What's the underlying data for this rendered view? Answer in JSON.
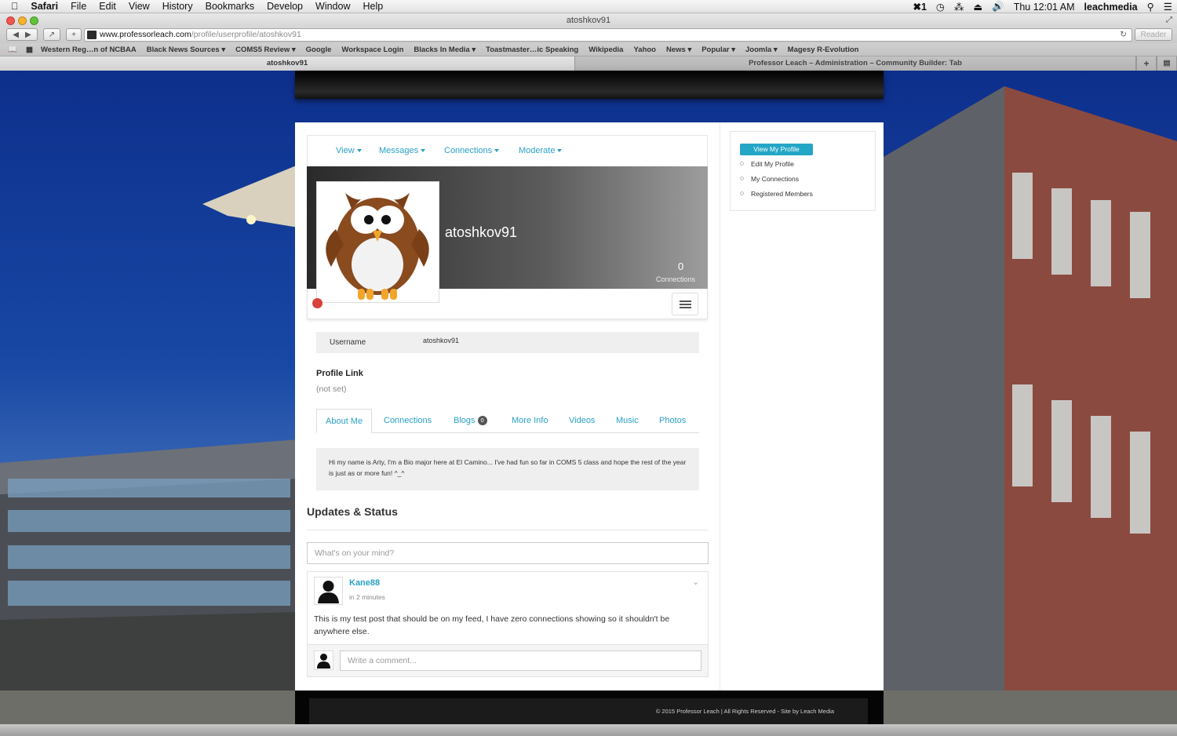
{
  "menubar": {
    "app": "Safari",
    "items": [
      "File",
      "Edit",
      "View",
      "History",
      "Bookmarks",
      "Develop",
      "Window",
      "Help"
    ],
    "status_badge": "1",
    "clock": "Thu 12:01 AM",
    "user": "leachmedia"
  },
  "window": {
    "title": "atoshkov91"
  },
  "toolbar": {
    "url_host": "www.professorleach.com",
    "url_path": "/profile/userprofile/atoshkov91",
    "reader_label": "Reader"
  },
  "bookmarks": [
    "Western Reg…n of NCBAA",
    "Black News Sources ▾",
    "COMS5 Review ▾",
    "Google",
    "Workspace Login",
    "Blacks In Media ▾",
    "Toastmaster…ic Speaking",
    "Wikipedia",
    "Yahoo",
    "News ▾",
    "Popular ▾",
    "Joomla ▾",
    "Magesy R-Evolution"
  ],
  "tabs": [
    {
      "label": "atoshkov91"
    },
    {
      "label": "Professor Leach – Administration – Community Builder: Tab"
    }
  ],
  "profile": {
    "nav": [
      "View",
      "Messages",
      "Connections",
      "Moderate"
    ],
    "display_name": "atoshkov91",
    "connections_count": "0",
    "connections_label": "Connections",
    "username_label": "Username",
    "username_value": "atoshkov91",
    "profile_link_title": "Profile Link",
    "profile_link_value": "(not set)",
    "tabs": [
      "About Me",
      "Connections",
      "Blogs",
      "More Info",
      "Videos",
      "Music",
      "Photos"
    ],
    "blogs_badge": "0",
    "about_text": "Hi my name is Arty, I'm a Bio major here at El Camino... I've had fun so far in COMS 5 class and hope the rest of the year is just as or more fun! ^_^"
  },
  "updates": {
    "title": "Updates & Status",
    "status_placeholder": "What's on your mind?",
    "post": {
      "author": "Kane88",
      "time": "in 2 minutes",
      "text": "This is my test post that should be on my feed, I have zero connections showing so it shouldn't be anywhere else."
    },
    "comment_placeholder": "Write a comment..."
  },
  "sidebar": {
    "items": [
      "View My Profile",
      "Edit My Profile",
      "My Connections",
      "Registered Members"
    ]
  },
  "footer": {
    "text": "© 2015 Professor Leach | All Rights Reserved - Site by Leach Media"
  },
  "colors": {
    "accent": "#2aa0c6",
    "button": "#24a6c6",
    "status_offline": "#d9403a"
  }
}
